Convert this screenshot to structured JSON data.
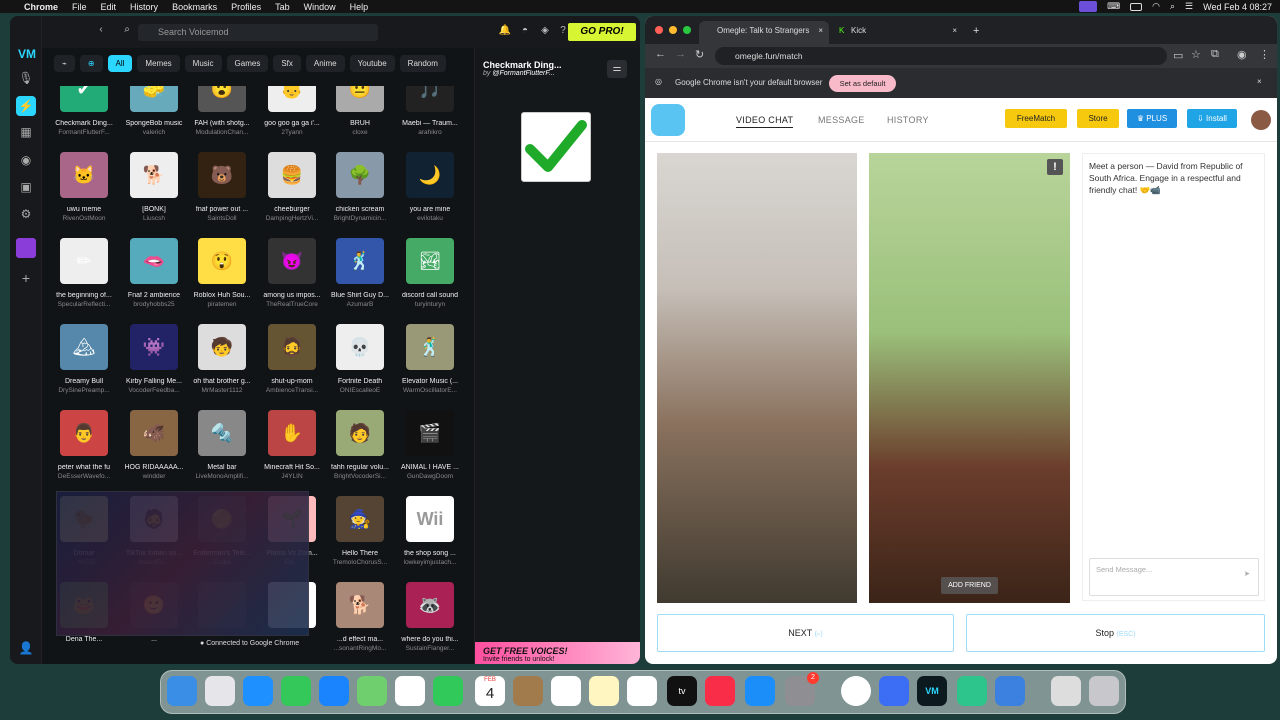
{
  "menubar": {
    "app": "Chrome",
    "items": [
      "File",
      "Edit",
      "History",
      "Bookmarks",
      "Profiles",
      "Tab",
      "Window",
      "Help"
    ],
    "clock": "Wed Feb 4  08:27"
  },
  "voicemod": {
    "search_placeholder": "Search Voicemod",
    "gopro": "GO PRO!",
    "categories": [
      "All",
      "Memes",
      "Music",
      "Games",
      "Sfx",
      "Anime",
      "Youtube",
      "Random"
    ],
    "selected_category": "All",
    "sounds": [
      {
        "name": "Checkmark Ding...",
        "author": "FormantFlutterF...",
        "icon": "✔",
        "bg": "#2a7"
      },
      {
        "name": "SpongeBob music",
        "author": "valerich",
        "icon": "🧽",
        "bg": "#6ab"
      },
      {
        "name": "FAH (with shotg...",
        "author": "ModulationChan...",
        "icon": "😮",
        "bg": "#555"
      },
      {
        "name": "goo goo ga ga i'...",
        "author": "2Tyann",
        "icon": "👶",
        "bg": "#eee"
      },
      {
        "name": "BRUH",
        "author": "cloxe",
        "icon": "😐",
        "bg": "#aaa"
      },
      {
        "name": "Maebi — Traum...",
        "author": "arahikro",
        "icon": "🎵",
        "bg": "#222"
      },
      {
        "name": "uwu meme",
        "author": "RivenOstMoon",
        "icon": "🐱",
        "bg": "#a68"
      },
      {
        "name": "[BONK]",
        "author": "Liuscsh",
        "icon": "🐕",
        "bg": "#eee"
      },
      {
        "name": "fnaf power out ...",
        "author": "SaintsDoll",
        "icon": "🐻",
        "bg": "#321"
      },
      {
        "name": "cheeburger",
        "author": "DampingHertzVi...",
        "icon": "🍔",
        "bg": "#ddd"
      },
      {
        "name": "chicken scream",
        "author": "BrightDynamicin...",
        "icon": "🌳",
        "bg": "#89a"
      },
      {
        "name": "you are mine",
        "author": "evilotaku",
        "icon": "🌙",
        "bg": "#123"
      },
      {
        "name": "the beginning of...",
        "author": "SpecularReflecti...",
        "icon": "✏",
        "bg": "#eee"
      },
      {
        "name": "Fnaf 2 ambience",
        "author": "brodyhobbs25",
        "icon": "🫦",
        "bg": "#5ab"
      },
      {
        "name": "Roblox Huh Sou...",
        "author": "piratemen",
        "icon": "😲",
        "bg": "#fd4"
      },
      {
        "name": "among us impos...",
        "author": "TheRealTrueCore",
        "icon": "😈",
        "bg": "#333"
      },
      {
        "name": "Blue Shirt Guy D...",
        "author": "AzumarB",
        "icon": "🕺",
        "bg": "#35a"
      },
      {
        "name": "discord call sound",
        "author": "turyinturyn",
        "icon": "🏞",
        "bg": "#4a6"
      },
      {
        "name": "Dreamy Bull",
        "author": "DrySinePreamp...",
        "icon": "🏔",
        "bg": "#58a"
      },
      {
        "name": "Kirby Falling Me...",
        "author": "VocoderFeedba...",
        "icon": "👾",
        "bg": "#226"
      },
      {
        "name": "oh that brother g...",
        "author": "MrMaster1112",
        "icon": "🧒",
        "bg": "#ddd"
      },
      {
        "name": "shut-up-mom",
        "author": "AmbienceTransi...",
        "icon": "🧔",
        "bg": "#653"
      },
      {
        "name": "Fortnite Death",
        "author": "ONIEscalleoE",
        "icon": "💀",
        "bg": "#eee"
      },
      {
        "name": "Elevator Music (...",
        "author": "WarmOscillatorE...",
        "icon": "🕺",
        "bg": "#997"
      },
      {
        "name": "peter what the fu",
        "author": "DeEsserWavefo...",
        "icon": "👨",
        "bg": "#c44"
      },
      {
        "name": "HOG RIDAAAAA...",
        "author": "windder",
        "icon": "🐗",
        "bg": "#864"
      },
      {
        "name": "Metal bar",
        "author": "LiveMonoAmplifi...",
        "icon": "🔩",
        "bg": "#888"
      },
      {
        "name": "Minecraft Hit So...",
        "author": "J4YLIN",
        "icon": "✋",
        "bg": "#b44"
      },
      {
        "name": "fahh regular volu...",
        "author": "BrightVocoderSi...",
        "icon": "🧑",
        "bg": "#9a7"
      },
      {
        "name": "ANIMAL I HAVE ...",
        "author": "GunDawgDoom",
        "icon": "🎬",
        "bg": "#111"
      },
      {
        "name": "Domar",
        "author": "...h8755",
        "icon": "🐤",
        "bg": "#fe8"
      },
      {
        "name": "TikTok Indian so...",
        "author": "MutedEc...",
        "icon": "🧔",
        "bg": "#ccc"
      },
      {
        "name": "Enderman's Tele...",
        "author": "...Crake...",
        "icon": "🟢",
        "bg": "#244"
      },
      {
        "name": "Plants Vs Zom...",
        "author": "Ele...",
        "icon": "🌱",
        "bg": "#fbb"
      },
      {
        "name": "Hello There",
        "author": "TremoloChorusS...",
        "icon": "🧙",
        "bg": "#543"
      },
      {
        "name": "the shop song ...",
        "author": "lowkeyimjustach...",
        "icon": "Wii",
        "bg": "#fff"
      },
      {
        "name": "Dena The...",
        "author": "",
        "icon": "🐸",
        "bg": "#4a4"
      },
      {
        "name": "...",
        "author": "",
        "icon": "🙂",
        "bg": "#333"
      },
      {
        "name": "",
        "author": "",
        "icon": "",
        "bg": "#333"
      },
      {
        "name": "",
        "author": "",
        "icon": "✔",
        "bg": "#fff"
      },
      {
        "name": "...d effect ma...",
        "author": "...sonantRingMo...",
        "icon": "🐕",
        "bg": "#a87"
      },
      {
        "name": "where do you thi...",
        "author": "SustainFlanger...",
        "icon": "🦝",
        "bg": "#a25"
      }
    ],
    "side": {
      "title": "Checkmark Ding...",
      "by_prefix": "by",
      "by_user": "@FormantFlutterF..."
    },
    "promo": {
      "line1": "GET FREE VOICES!",
      "line2": "Invite friends to unlock!"
    },
    "connected": "Connected to Google Chrome"
  },
  "chrome": {
    "tabs": [
      {
        "label": "Omegle: Talk to Strangers",
        "active": true
      },
      {
        "label": "Kick",
        "active": false
      }
    ],
    "url": "omegle.fun/match",
    "info_text": "Google Chrome isn't your default browser",
    "set_default": "Set as default"
  },
  "omegle": {
    "nav": [
      "VIDEO CHAT",
      "MESSAGE",
      "HISTORY"
    ],
    "buttons": {
      "freematch": "FreeMatch",
      "store": "Store",
      "plus": "PLUS",
      "install": "Install"
    },
    "add_friend": "ADD FRIEND",
    "chat_message": "Meet a person — David from Republic of South Africa. Engage in a respectful and friendly chat! 🤝📹",
    "send_placeholder": "Send Message...",
    "next": "NEXT",
    "next_key": "(▹)",
    "stop": "Stop",
    "stop_key": "(ESC)"
  },
  "dock": {
    "calendar_month": "FEB",
    "calendar_day": "4",
    "settings_badge": "2"
  }
}
